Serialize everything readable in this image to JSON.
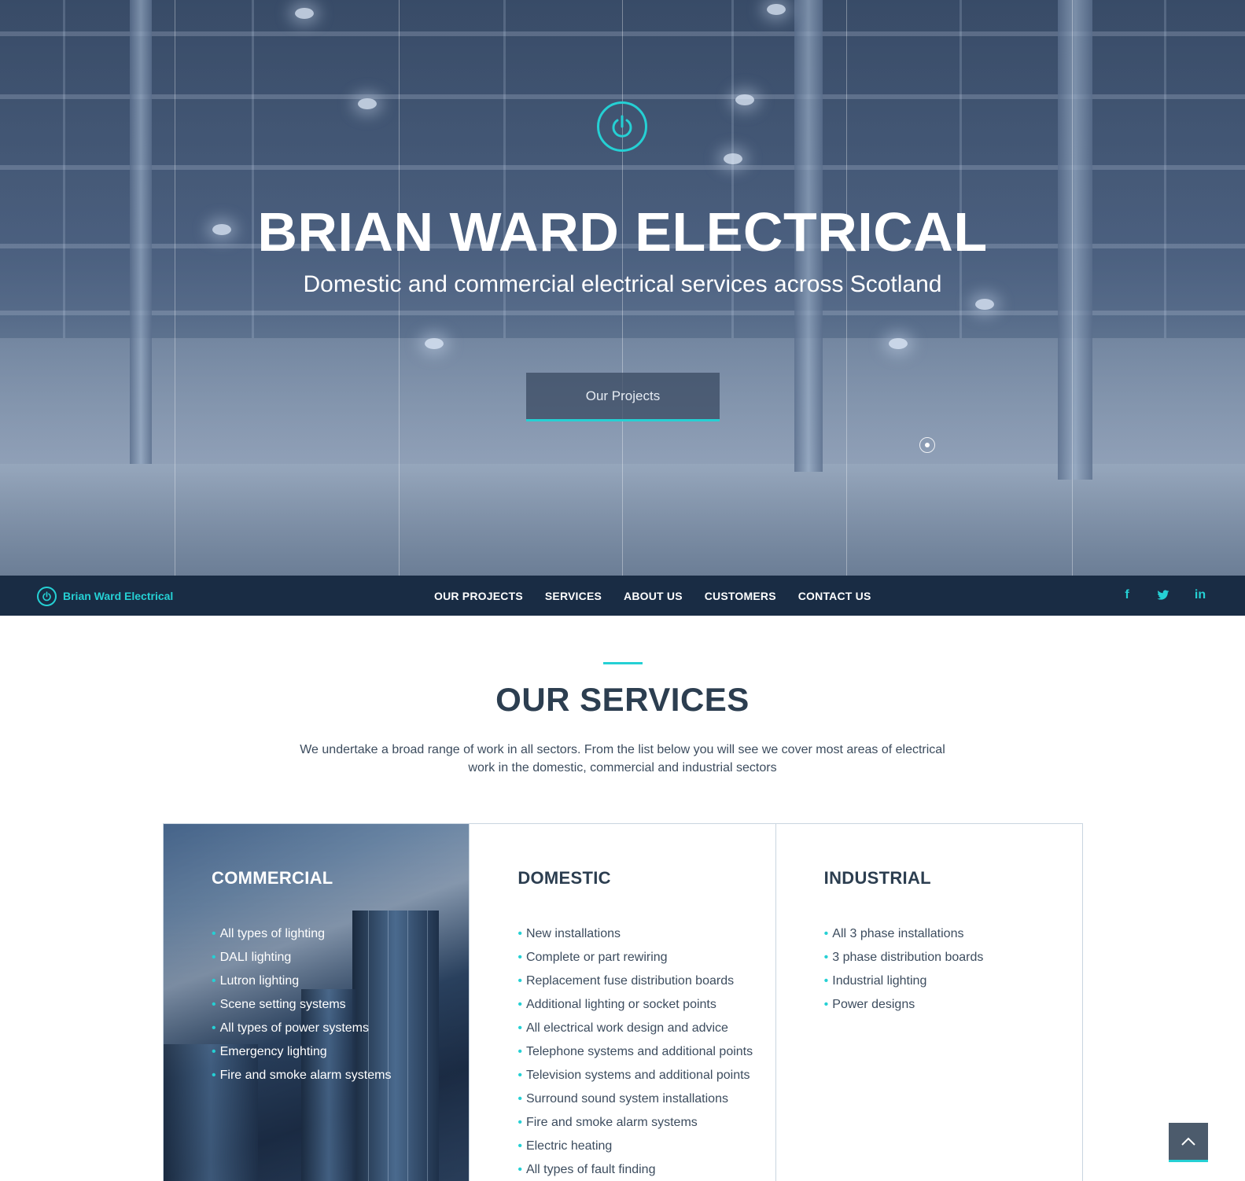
{
  "hero": {
    "title": "BRIAN WARD ELECTRICAL",
    "subtitle": "Domestic and commercial electrical services across Scotland",
    "button_label": "Our Projects",
    "logo_icon": "power-icon",
    "slide_indicator_icon": "slide-dot-icon"
  },
  "navbar": {
    "brand": "Brian Ward Electrical",
    "brand_icon": "power-icon",
    "links": [
      "OUR PROJECTS",
      "SERVICES",
      "ABOUT US",
      "CUSTOMERS",
      "CONTACT US"
    ],
    "social": {
      "facebook": "f",
      "twitter": "twitter-icon",
      "linkedin": "in"
    }
  },
  "services": {
    "title": "OUR SERVICES",
    "description": "We undertake a broad range of work in all sectors. From the list below you will see we cover most areas of electrical work in the domestic, commercial and industrial sectors",
    "cards": [
      {
        "title": "COMMERCIAL",
        "items": [
          "All types of lighting",
          "DALI lighting",
          "Lutron lighting",
          "Scene setting systems",
          "All types of power systems",
          "Emergency lighting",
          "Fire and smoke alarm systems"
        ]
      },
      {
        "title": "DOMESTIC",
        "items": [
          "New installations",
          "Complete or part rewiring",
          "Replacement fuse distribution boards",
          "Additional lighting or socket points",
          "All electrical work design and advice",
          "Telephone systems and additional points",
          "Television systems and additional points",
          "Surround sound system installations",
          "Fire and smoke alarm systems",
          "Electric heating",
          "All types of fault finding"
        ]
      },
      {
        "title": "INDUSTRIAL",
        "items": [
          "All 3 phase installations",
          "3 phase distribution boards",
          "Industrial lighting",
          "Power designs"
        ]
      }
    ]
  },
  "scroll_top_icon": "chevron-up-icon",
  "colors": {
    "accent": "#25d0d4",
    "navbar_bg": "#192c44",
    "heading": "#2c3e50"
  }
}
